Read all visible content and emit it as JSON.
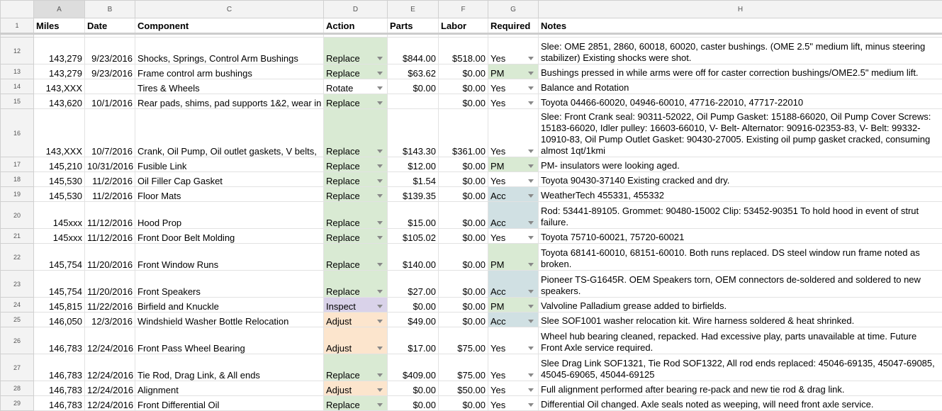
{
  "column_letters": [
    "A",
    "B",
    "C",
    "D",
    "E",
    "F",
    "G",
    "H"
  ],
  "header_row_number": "1",
  "headers": [
    "Miles",
    "Date",
    "Component",
    "Action",
    "Parts",
    "Labor",
    "Required",
    "Notes"
  ],
  "rows": [
    {
      "num": "12",
      "miles": "143,279",
      "date": "9/23/2016",
      "component": "Shocks, Springs, Control Arm Bushings",
      "action": "Replace",
      "parts": "$844.00",
      "labor": "$518.00",
      "required": "Yes",
      "notes": "Slee: OME 2851, 2860, 60018, 60020, caster bushings. (OME 2.5\" medium lift, minus steering stabilizer) Existing shocks were shot."
    },
    {
      "num": "13",
      "miles": "143,279",
      "date": "9/23/2016",
      "component": "Frame control arm bushings",
      "action": "Replace",
      "parts": "$63.62",
      "labor": "$0.00",
      "required": "PM",
      "notes": "Bushings pressed in while arms were off for caster correction bushings/OME2.5\" medium lift."
    },
    {
      "num": "14",
      "miles": "143,XXX",
      "date": "",
      "component": "Tires & Wheels",
      "action": "Rotate",
      "parts": "$0.00",
      "labor": "$0.00",
      "required": "Yes",
      "notes": "Balance and Rotation"
    },
    {
      "num": "15",
      "miles": "143,620",
      "date": "10/1/2016",
      "component": "Rear pads, shims, pad supports 1&2, wear in",
      "action": "Replace",
      "parts": "",
      "labor": "$0.00",
      "required": "Yes",
      "notes": "Toyota 04466-60020, 04946-60010, 47716-22010, 47717-22010"
    },
    {
      "num": "16",
      "miles": "143,XXX",
      "date": "10/7/2016",
      "component": "Crank, Oil Pump, Oil outlet gaskets, V belts,",
      "action": "Replace",
      "parts": "$143.30",
      "labor": "$361.00",
      "required": "Yes",
      "notes": "Slee: Front Crank seal: 90311-52022, Oil Pump Gasket: 15188-66020, Oil Pump Cover Screws: 15183-66020, Idler pulley: 16603-66010, V- Belt- Alternator: 90916-02353-83, V- Belt: 99332-10910-83, Oil Pump Outlet Gasket: 90430-27005. Existing oil pump gasket cracked, consuming almost 1qt/1kmi"
    },
    {
      "num": "17",
      "miles": "145,210",
      "date": "10/31/2016",
      "component": "Fusible Link",
      "action": "Replace",
      "parts": "$12.00",
      "labor": "$0.00",
      "required": "PM",
      "notes": "PM- insulators were looking aged."
    },
    {
      "num": "18",
      "miles": "145,530",
      "date": "11/2/2016",
      "component": "Oil Filler Cap Gasket",
      "action": "Replace",
      "parts": "$1.54",
      "labor": "$0.00",
      "required": "Yes",
      "notes": "Toyota 90430-37140 Existing cracked and dry."
    },
    {
      "num": "19",
      "miles": "145,530",
      "date": "11/2/2016",
      "component": "Floor Mats",
      "action": "Replace",
      "parts": "$139.35",
      "labor": "$0.00",
      "required": "Acc",
      "notes": "WeatherTech 455331, 455332"
    },
    {
      "num": "20",
      "miles": "145xxx",
      "date": "11/12/2016",
      "component": "Hood Prop",
      "action": "Replace",
      "parts": "$15.00",
      "labor": "$0.00",
      "required": "Acc",
      "notes": "Rod: 53441-89105. Grommet: 90480-15002 Clip: 53452-90351 To hold hood in event of strut failure."
    },
    {
      "num": "21",
      "miles": "145xxx",
      "date": "11/12/2016",
      "component": "Front Door Belt Molding",
      "action": "Replace",
      "parts": "$105.02",
      "labor": "$0.00",
      "required": "Yes",
      "notes": "Toyota 75710-60021, 75720-60021"
    },
    {
      "num": "22",
      "miles": "145,754",
      "date": "11/20/2016",
      "component": "Front Window Runs",
      "action": "Replace",
      "parts": "$140.00",
      "labor": "$0.00",
      "required": "PM",
      "notes": "Toyota 68141-60010, 68151-60010. Both runs replaced. DS steel window run frame noted as broken."
    },
    {
      "num": "23",
      "miles": "145,754",
      "date": "11/20/2016",
      "component": "Front Speakers",
      "action": "Replace",
      "parts": "$27.00",
      "labor": "$0.00",
      "required": "Acc",
      "notes": "Pioneer TS-G1645R. OEM Speakers torn, OEM connectors de-soldered and soldered to new speakers."
    },
    {
      "num": "24",
      "miles": "145,815",
      "date": "11/22/2016",
      "component": "Birfield and Knuckle",
      "action": "Inspect",
      "parts": "$0.00",
      "labor": "$0.00",
      "required": "PM",
      "notes": "Valvoline Palladium grease added to birfields."
    },
    {
      "num": "25",
      "miles": "146,050",
      "date": "12/3/2016",
      "component": "Windshield Washer Bottle Relocation",
      "action": "Adjust",
      "parts": "$49.00",
      "labor": "$0.00",
      "required": "Acc",
      "notes": "Slee SOF1001 washer relocation kit. Wire harness soldered & heat shrinked."
    },
    {
      "num": "26",
      "miles": "146,783",
      "date": "12/24/2016",
      "component": "Front Pass Wheel Bearing",
      "action": "Adjust",
      "parts": "$17.00",
      "labor": "$75.00",
      "required": "Yes",
      "notes": "Wheel hub bearing cleaned, repacked. Had excessive play, parts unavailable at time. Future Front Axle service required."
    },
    {
      "num": "27",
      "miles": "146,783",
      "date": "12/24/2016",
      "component": "Tie Rod, Drag Link, & All ends",
      "action": "Replace",
      "parts": "$409.00",
      "labor": "$75.00",
      "required": "Yes",
      "notes": "Slee Drag Link SOF1321, Tie Rod SOF1322, All rod ends replaced: 45046-69135, 45047-69085, 45045-69065, 45044-69125"
    },
    {
      "num": "28",
      "miles": "146,783",
      "date": "12/24/2016",
      "component": "Alignment",
      "action": "Adjust",
      "parts": "$0.00",
      "labor": "$50.00",
      "required": "Yes",
      "notes": "Full alignment performed after bearing re-pack and new tie rod & drag link."
    },
    {
      "num": "29",
      "miles": "146,783",
      "date": "12/24/2016",
      "component": "Front Differential Oil",
      "action": "Replace",
      "parts": "$0.00",
      "labor": "$0.00",
      "required": "Yes",
      "notes": "Differential Oil changed. Axle seals noted as weeping, will need front axle service."
    }
  ],
  "colors": {
    "replace": "#d9ead3",
    "inspect": "#d9d2e9",
    "adjust": "#fce5cd",
    "pm": "#d9ead3",
    "acc": "#d0e0e3"
  }
}
